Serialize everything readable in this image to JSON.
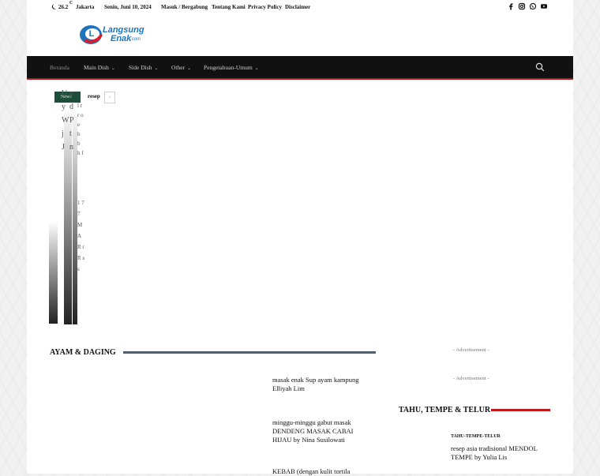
{
  "topbar": {
    "temperature": "26.2",
    "temp_unit": "C",
    "city": "Jakarta",
    "date": "Senin, Juni 10, 2024",
    "links": [
      "Masuk / Bergabung",
      "Tentang Kami",
      "Privacy Policy",
      "Disclaimer"
    ]
  },
  "logo": {
    "line1": "Langsung",
    "line2": "Enak",
    "suffix": ".com",
    "brand_blue": "#1e73be",
    "brand_red": "#d81e2a"
  },
  "nav": {
    "items": [
      {
        "label": "Beranda",
        "dropdown": false
      },
      {
        "label": "Main Dish",
        "dropdown": true
      },
      {
        "label": "Side Dish",
        "dropdown": true
      },
      {
        "label": "Other",
        "dropdown": true
      },
      {
        "label": "Pengetahuan-Umum",
        "dropdown": true
      }
    ],
    "chevron": "⌄",
    "search_icon": "search-icon",
    "accent": "#c0171d"
  },
  "ticker": {
    "badge": "News",
    "title": "resep",
    "next": "›"
  },
  "broken_slider": {
    "col1": "U y W j J",
    "col2": "p d P t n",
    "col3": "l r r o e b b h f",
    "col4": "1 7 7 MA R r R s s"
  },
  "left_section": {
    "title": "AYAM & DAGING",
    "articles": [
      "masak enak Sup ayam kampung Elliyah Lim",
      "minggu-minggu gabut masak DENDENG MASAK CABAI HIJAU by Nina Susilowati",
      "KEBAB (dengan kulit tortila"
    ]
  },
  "sidebar": {
    "ad1": "- Advertisement -",
    "ad2": "- Advertisement -",
    "section_title": "TAHU, TEMPE & TELUR",
    "category": "TAHU-TEMPE-TELUR",
    "article": "resep asia tradisional MENDOL TEMPE by Yulia Lis"
  }
}
